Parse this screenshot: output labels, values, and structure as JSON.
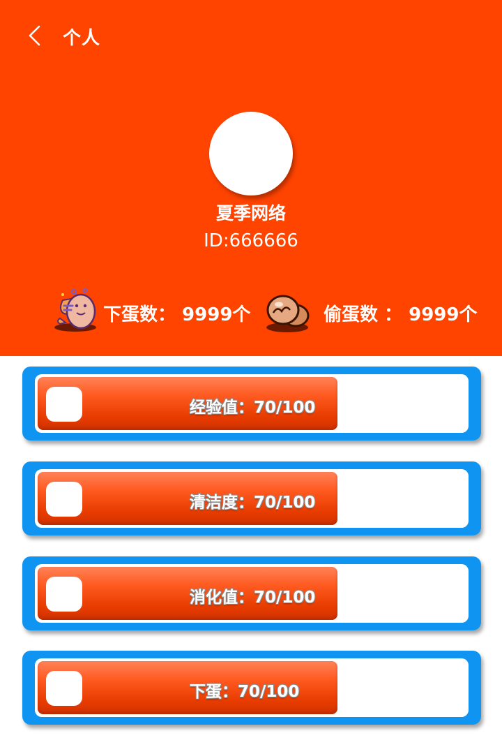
{
  "header": {
    "title": "个人",
    "back_icon": "chevron-left-icon",
    "background": "#ff4400"
  },
  "profile": {
    "avatar": "avatar-placeholder",
    "name": "夏季网络",
    "id_text": "ID:666666"
  },
  "stats": [
    {
      "icon": "egg-character-icon",
      "text": "下蛋数： 9999个"
    },
    {
      "icon": "egg-pair-icon",
      "text": "偷蛋数 ： 9999个"
    }
  ],
  "progress": [
    {
      "label": "经验值：70/100",
      "value": 70,
      "max": 100
    },
    {
      "label": "清洁度：70/100",
      "value": 70,
      "max": 100
    },
    {
      "label": "消化值：70/100",
      "value": 70,
      "max": 100
    },
    {
      "label": "下蛋：70/100",
      "value": 70,
      "max": 100
    }
  ],
  "colors": {
    "accent": "#ff4400",
    "card_border": "#0f94f2",
    "bar_fill": "#ff5a20"
  }
}
